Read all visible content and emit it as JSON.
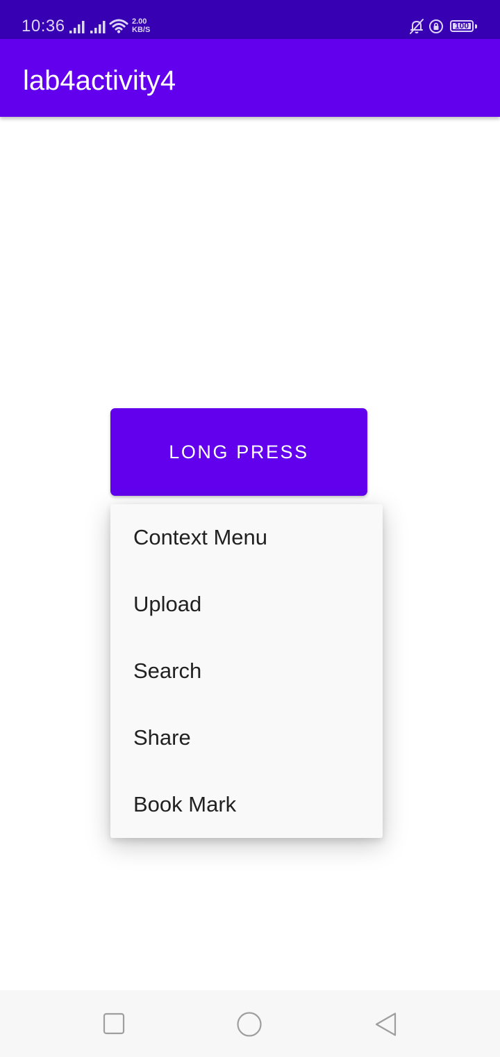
{
  "status_bar": {
    "time": "10:36",
    "net_speed_value": "2.00",
    "net_speed_unit": "KB/S",
    "battery": "100",
    "icons": [
      "signal-icon",
      "signal-icon",
      "wifi-icon",
      "mute-bell-icon",
      "rotation-lock-icon",
      "battery-icon"
    ]
  },
  "app_bar": {
    "title": "lab4activity4",
    "color": "#6200ee"
  },
  "main": {
    "button_label": "LONG PRESS"
  },
  "context_menu": {
    "header": "Context Menu",
    "items": [
      {
        "label": "Upload"
      },
      {
        "label": "Search"
      },
      {
        "label": "Share"
      },
      {
        "label": "Book Mark"
      }
    ]
  },
  "nav_bar": {
    "icons": [
      "recents-square-icon",
      "home-circle-icon",
      "back-triangle-icon"
    ]
  },
  "colors": {
    "status_bar": "#3700b3",
    "primary": "#6200ee",
    "menu_background": "#f9f9f9"
  }
}
